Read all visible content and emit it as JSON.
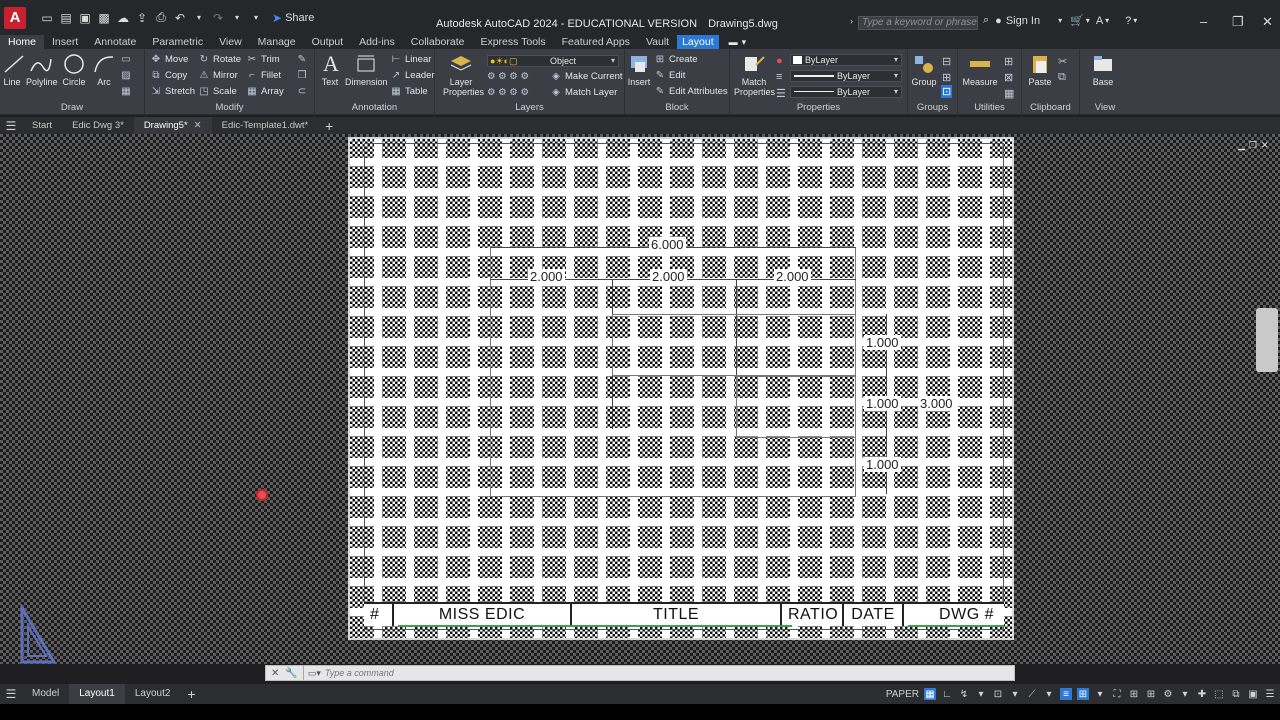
{
  "titlebar": {
    "app_logo": "A",
    "share_label": "Share",
    "app_title": "Autodesk AutoCAD 2024 - EDUCATIONAL VERSION",
    "file_name": "Drawing5.dwg",
    "search_placeholder": "Type a keyword or phrase",
    "sign_in": "Sign In"
  },
  "ribbon_tabs": [
    "Home",
    "Insert",
    "Annotate",
    "Parametric",
    "View",
    "Manage",
    "Output",
    "Add-ins",
    "Collaborate",
    "Express Tools",
    "Featured Apps",
    "Vault",
    "Layout"
  ],
  "ribbon": {
    "draw": {
      "title": "Draw",
      "line": "Line",
      "polyline": "Polyline",
      "circle": "Circle",
      "arc": "Arc"
    },
    "modify": {
      "title": "Modify",
      "move": "Move",
      "rotate": "Rotate",
      "trim": "Trim",
      "copy": "Copy",
      "mirror": "Mirror",
      "fillet": "Fillet",
      "stretch": "Stretch",
      "scale": "Scale",
      "array": "Array"
    },
    "annotation": {
      "title": "Annotation",
      "text": "Text",
      "dimension": "Dimension",
      "linear": "Linear",
      "leader": "Leader",
      "table": "Table"
    },
    "layers": {
      "title": "Layers",
      "layer_properties": "Layer Properties",
      "current_layer": "Object",
      "make_current": "Make Current",
      "match_layer": "Match Layer"
    },
    "block": {
      "title": "Block",
      "insert": "Insert",
      "create": "Create",
      "edit": "Edit",
      "edit_attributes": "Edit Attributes"
    },
    "properties": {
      "title": "Properties",
      "match_properties": "Match Properties",
      "color": "ByLayer",
      "linetype": "ByLayer",
      "lineweight": "ByLayer"
    },
    "groups": {
      "title": "Groups",
      "group": "Group"
    },
    "utilities": {
      "title": "Utilities",
      "measure": "Measure"
    },
    "clipboard": {
      "title": "Clipboard",
      "paste": "Paste"
    },
    "view": {
      "title": "View",
      "base": "Base"
    }
  },
  "file_tabs": [
    {
      "label": "Start"
    },
    {
      "label": "Edic Dwg 3*"
    },
    {
      "label": "Drawing5*"
    },
    {
      "label": "Edic-Template1.dwt*"
    }
  ],
  "drawing": {
    "dim_top": "6.000",
    "dim_a": "2.000",
    "dim_b": "2.000",
    "dim_c": "2.000",
    "dim_r1": "1.000",
    "dim_r2": "1.000",
    "dim_r3": "3.000",
    "dim_r4": "1.000",
    "titleblock": {
      "num": "#",
      "name": "MISS EDIC",
      "title": "TITLE",
      "ratio": "RATIO",
      "date": "DATE",
      "dwg": "DWG #"
    }
  },
  "command_line": {
    "placeholder": "Type a command"
  },
  "statusbar": {
    "tabs": [
      "Model",
      "Layout1",
      "Layout2"
    ],
    "space": "PAPER"
  },
  "colors": {
    "accent": "#2b79d5",
    "brand": "#c8202e",
    "ribbon_bg": "#3b3f45"
  }
}
